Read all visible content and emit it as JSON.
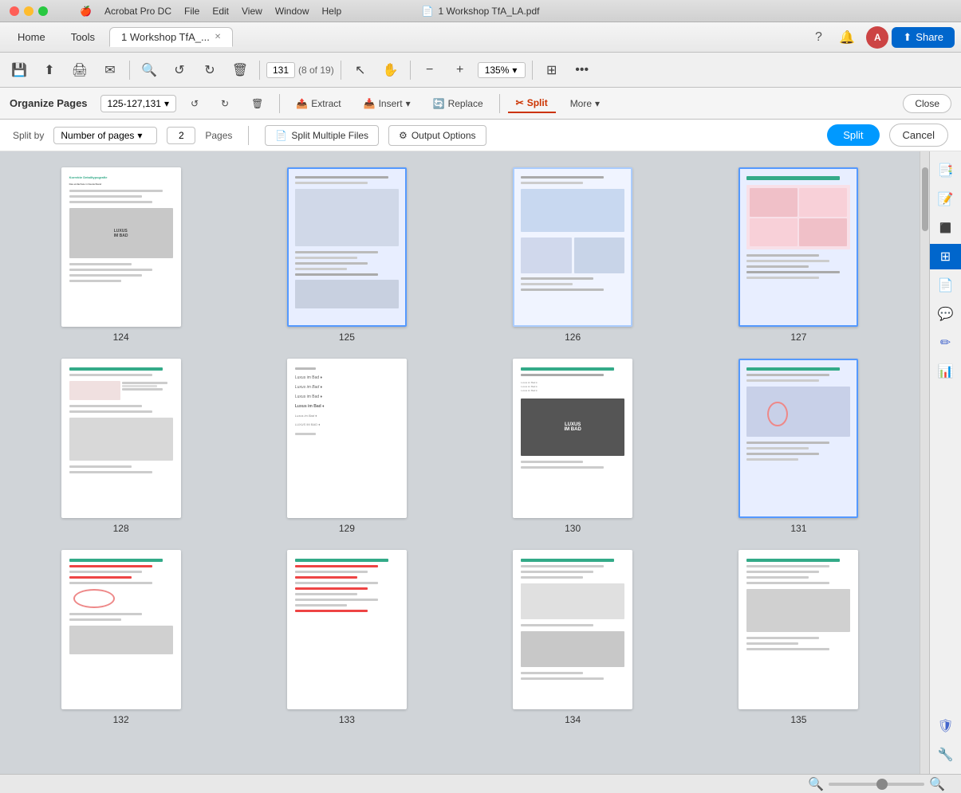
{
  "titleBar": {
    "title": "1  Workshop TfA_LA.pdf",
    "appName": "Acrobat Pro DC",
    "pdfIcon": "📄"
  },
  "macMenu": {
    "apple": "🍎",
    "items": [
      "Acrobat Pro DC",
      "File",
      "Edit",
      "View",
      "Window",
      "Help"
    ]
  },
  "tabs": {
    "home": "Home",
    "tools": "Tools",
    "active": "1  Workshop TfA_...",
    "close": "✕"
  },
  "toolbar": {
    "saveIcon": "💾",
    "uploadIcon": "⬆",
    "printIcon": "🖨",
    "emailIcon": "✉",
    "zoomOutIcon": "🔍",
    "undoIcon": "↺",
    "redoIcon": "↻",
    "deleteIcon": "🗑",
    "pageNum": "131",
    "pageInfo": "(8 of 19)",
    "cursorIcon": "↖",
    "handIcon": "✋",
    "zoomOutBtn": "−",
    "zoomInBtn": "+",
    "zoomLevel": "135%",
    "zoomDropdown": "▾",
    "layoutIcon": "⊞",
    "moreIcon": "•••",
    "shareLabel": "Share"
  },
  "organizeBar": {
    "title": "Organize Pages",
    "pageRange": "125-127,131",
    "dropdown": "▾",
    "undoIcon": "↺",
    "redoIcon": "↻",
    "deleteIcon": "🗑",
    "extractLabel": "Extract",
    "insertLabel": "Insert",
    "insertDropdown": "▾",
    "replaceLabel": "Replace",
    "splitLabel": "Split",
    "moreLabel": "More",
    "moreDropdown": "▾",
    "closeLabel": "Close"
  },
  "splitBar": {
    "splitByLabel": "Split by",
    "splitByValue": "Number of pages",
    "splitByDropdown": "▾",
    "pagesValue": "2",
    "pagesLabel": "Pages",
    "splitMultipleLabel": "Split Multiple Files",
    "outputOptionsLabel": "Output Options",
    "splitActionLabel": "Split",
    "cancelLabel": "Cancel"
  },
  "pages": [
    {
      "num": "124",
      "selected": false
    },
    {
      "num": "125",
      "selected": true
    },
    {
      "num": "126",
      "selected": true
    },
    {
      "num": "127",
      "selected": true
    },
    {
      "num": "128",
      "selected": false
    },
    {
      "num": "129",
      "selected": false
    },
    {
      "num": "130",
      "selected": false
    },
    {
      "num": "131",
      "selected": true
    },
    {
      "num": "132",
      "selected": false
    },
    {
      "num": "133",
      "selected": false
    },
    {
      "num": "134",
      "selected": false
    },
    {
      "num": "135",
      "selected": false
    }
  ],
  "rightPanel": {
    "icons": [
      "📑",
      "📝",
      "🖊",
      "⚡",
      "💬",
      "✏",
      "📊",
      "🛡",
      "🔧"
    ]
  },
  "bottomBar": {
    "zoomMin": "−",
    "zoomMax": "+"
  }
}
